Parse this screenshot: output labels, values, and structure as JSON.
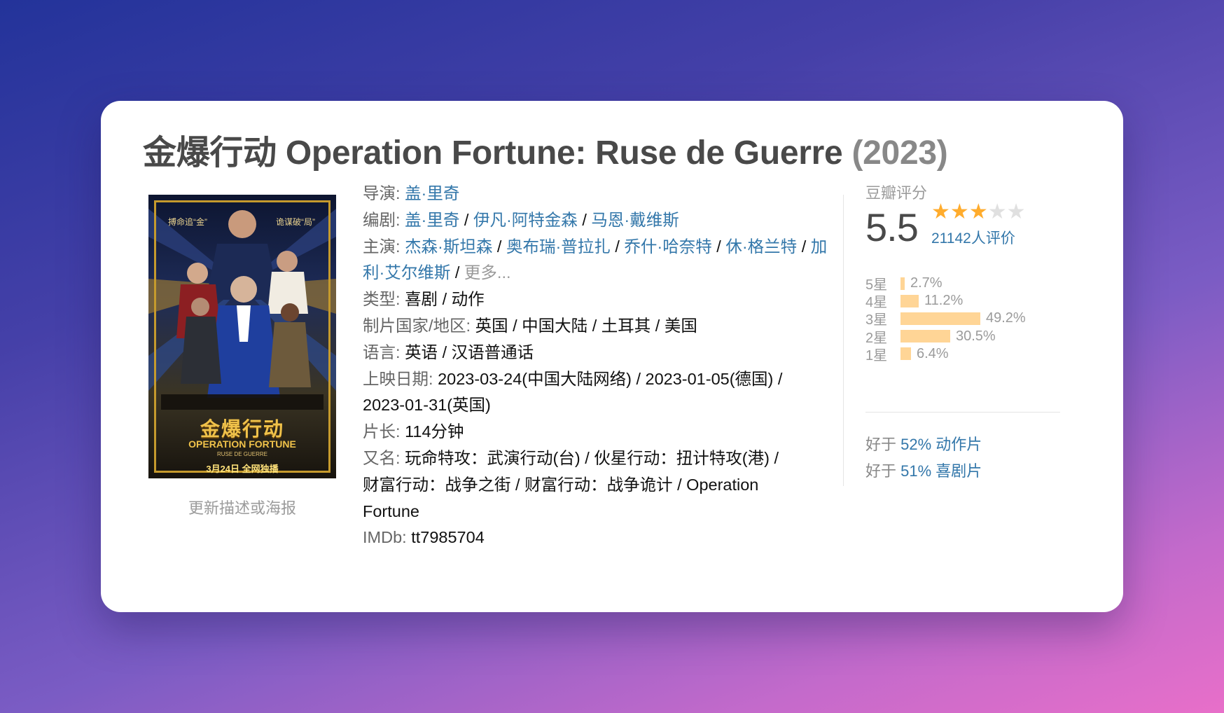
{
  "movie": {
    "title_cn": "金爆行动",
    "title_en": "Operation Fortune: Ruse de Guerre",
    "year": "(2023)"
  },
  "poster": {
    "tag_left": "搏命追“金”",
    "tag_right": "诡谋破“局”",
    "cn_title": "金爆行动",
    "en_title": "OPERATION FORTUNE",
    "sub_title": "RUSE DE GUERRE",
    "release_text": "3月24日 全网独播",
    "update_link": "更新描述或海报"
  },
  "info": {
    "director_label": "导演:",
    "director": "盖·里奇",
    "writer_label": "编剧:",
    "writers": [
      "盖·里奇",
      "伊凡·阿特金森",
      "马恩·戴维斯"
    ],
    "cast_label": "主演:",
    "cast": [
      "杰森·斯坦森",
      "奥布瑞·普拉扎",
      "乔什·哈奈特",
      "休·格兰特",
      "加利·艾尔维斯"
    ],
    "cast_more": "更多...",
    "genre_label": "类型:",
    "genre": "喜剧 / 动作",
    "country_label": "制片国家/地区:",
    "country": "英国 / 中国大陆 / 土耳其 / 美国",
    "language_label": "语言:",
    "language": "英语 / 汉语普通话",
    "release_label": "上映日期:",
    "release_1": "2023-03-24(中国大陆网络) / 2023-01-05(德国) /",
    "release_2": "2023-01-31(英国)",
    "runtime_label": "片长:",
    "runtime": "114分钟",
    "aka_label": "又名:",
    "aka_1": "玩命特攻：武演行动(台) / 伙星行动：扭计特攻(港) /",
    "aka_2": "财富行动：战争之街 / 财富行动：战争诡计 / Operation",
    "aka_3": "Fortune",
    "imdb_label": "IMDb:",
    "imdb": "tt7985704"
  },
  "rating": {
    "label": "豆瓣评分",
    "score": "5.5",
    "stars_filled": 3,
    "stars_total": 5,
    "votes": "21142人评价",
    "distribution": [
      {
        "label": "5星",
        "pct_text": "2.7%",
        "pct": 2.7
      },
      {
        "label": "4星",
        "pct_text": "11.2%",
        "pct": 11.2
      },
      {
        "label": "3星",
        "pct_text": "49.2%",
        "pct": 49.2
      },
      {
        "label": "2星",
        "pct_text": "30.5%",
        "pct": 30.5
      },
      {
        "label": "1星",
        "pct_text": "6.4%",
        "pct": 6.4
      }
    ],
    "better_than": [
      {
        "prefix": "好于",
        "link": "52% 动作片"
      },
      {
        "prefix": "好于",
        "link": "51% 喜剧片"
      }
    ]
  },
  "colors": {
    "link": "#3377aa",
    "star_on": "#ffac2d",
    "star_off": "#e0e0e0",
    "bar": "#ffd596"
  }
}
